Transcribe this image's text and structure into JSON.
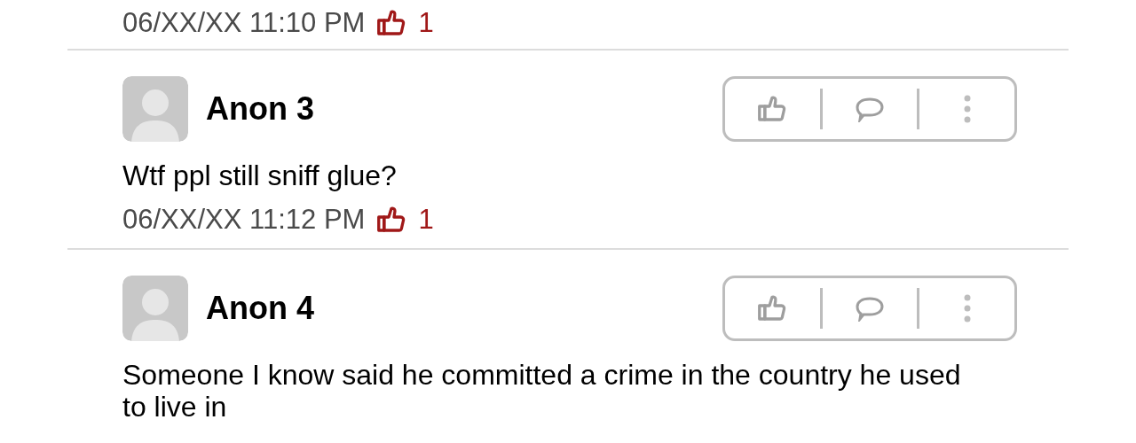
{
  "top_comment": {
    "timestamp": "06/XX/XX 11:10 PM",
    "likes": "1"
  },
  "comments": [
    {
      "author": "Anon 3",
      "text": "Wtf ppl still sniff glue?",
      "timestamp": "06/XX/XX 11:12 PM",
      "likes": "1"
    },
    {
      "author": "Anon 4",
      "text": "Someone I know said he committed a crime in the country he used to live in"
    }
  ]
}
